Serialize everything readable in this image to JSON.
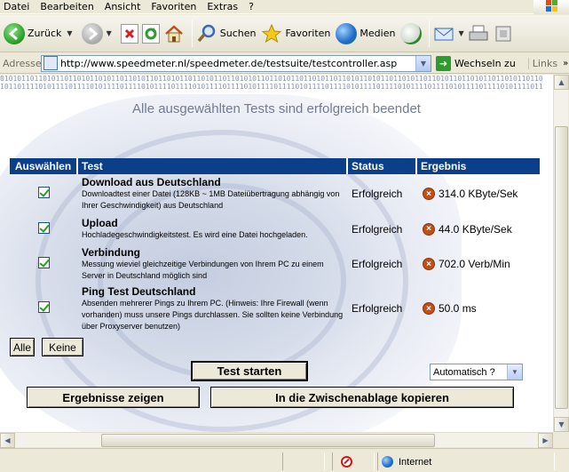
{
  "menu": {
    "items": [
      "Datei",
      "Bearbeiten",
      "Ansicht",
      "Favoriten",
      "Extras",
      "?"
    ]
  },
  "toolbar": {
    "back_label": "Zurück",
    "search_label": "Suchen",
    "favorites_label": "Favoriten",
    "media_label": "Medien"
  },
  "address": {
    "label": "Adresse",
    "url": "http://www.speedmeter.nl/speedmeter.de/testsuite/testcontroller.asp",
    "go_label": "Wechseln zu",
    "links_label": "Links"
  },
  "page": {
    "binary_line1": "0101011011010110110101101011011010110110101101101011011010101101101011011010110110101101011011010110110101101101011011010110110",
    "binary_line2": "1011011110101111011110101111011110101111011110101111011110101111011110101111011110101111011110101111011110101111011110101111011",
    "title": "Alle ausgewählten Tests sind erfolgreich beendet",
    "table": {
      "headers": [
        "Auswählen",
        "Test",
        "Status",
        "Ergebnis"
      ],
      "rows": [
        {
          "checked": true,
          "name": "Download aus Deutschland",
          "description": "Downloadtest einer Datei (128KB ~ 1MB Dateiübertragung abhängig von Ihrer Geschwindigkeit) aus Deutschland",
          "status": "Erfolgreich",
          "result": "314.0 KByte/Sek"
        },
        {
          "checked": true,
          "name": "Upload",
          "description": "Hochladegeschwindigkeitstest. Es wird eine Datei hochgeladen.",
          "status": "Erfolgreich",
          "result": "44.0 KByte/Sek"
        },
        {
          "checked": true,
          "name": "Verbindung",
          "description": "Messung wieviel gleichzeitige Verbindungen von Ihrem PC zu einem Server in Deutschland möglich sind",
          "status": "Erfolgreich",
          "result": "702.0 Verb/Min"
        },
        {
          "checked": true,
          "name": "Ping Test Deutschland",
          "description": "Absenden mehrerer Pings zu Ihrem PC. (Hinweis: Ihre Firewall (wenn vorhanden) muss unsere Pings durchlassen. Sie sollten keine Verbindung über Proxyserver benutzen)",
          "status": "Erfolgreich",
          "result": "50.0 ms"
        }
      ]
    },
    "btn_all": "Alle",
    "btn_none": "Keine",
    "btn_start": "Test starten",
    "select_value": "Automatisch ?",
    "btn_show_results": "Ergebnisse zeigen",
    "btn_copy": "In die Zwischenablage kopieren"
  },
  "statusbar": {
    "zone": "Internet"
  },
  "colors": {
    "header_bg": "#0b3f8a",
    "title_text": "#737b8f",
    "check_green": "#21a121",
    "result_icon": "#c0501a"
  }
}
